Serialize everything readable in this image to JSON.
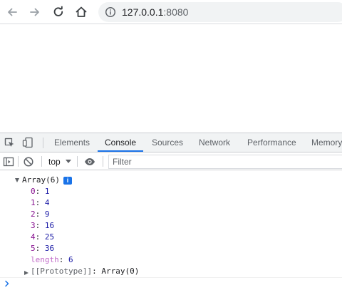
{
  "browser": {
    "url_host": "127.0.0.1",
    "url_port": ":8080"
  },
  "devtools": {
    "tabs": [
      {
        "label": "Elements"
      },
      {
        "label": "Console"
      },
      {
        "label": "Sources"
      },
      {
        "label": "Network"
      },
      {
        "label": "Performance"
      },
      {
        "label": "Memory"
      }
    ],
    "active_tab": "Console",
    "context": "top",
    "filter_placeholder": "Filter"
  },
  "console": {
    "array_label": "Array(6)",
    "info_badge": "i",
    "entries": [
      {
        "key": "0",
        "value": "1"
      },
      {
        "key": "1",
        "value": "4"
      },
      {
        "key": "2",
        "value": "9"
      },
      {
        "key": "3",
        "value": "16"
      },
      {
        "key": "4",
        "value": "25"
      },
      {
        "key": "5",
        "value": "36"
      }
    ],
    "length_key": "length",
    "length_value": "6",
    "prototype_label": "[[Prototype]]",
    "prototype_value": "Array(0)"
  },
  "colors": {
    "accent": "#1a73e8",
    "key": "#881391",
    "number": "#1a1aa6"
  }
}
